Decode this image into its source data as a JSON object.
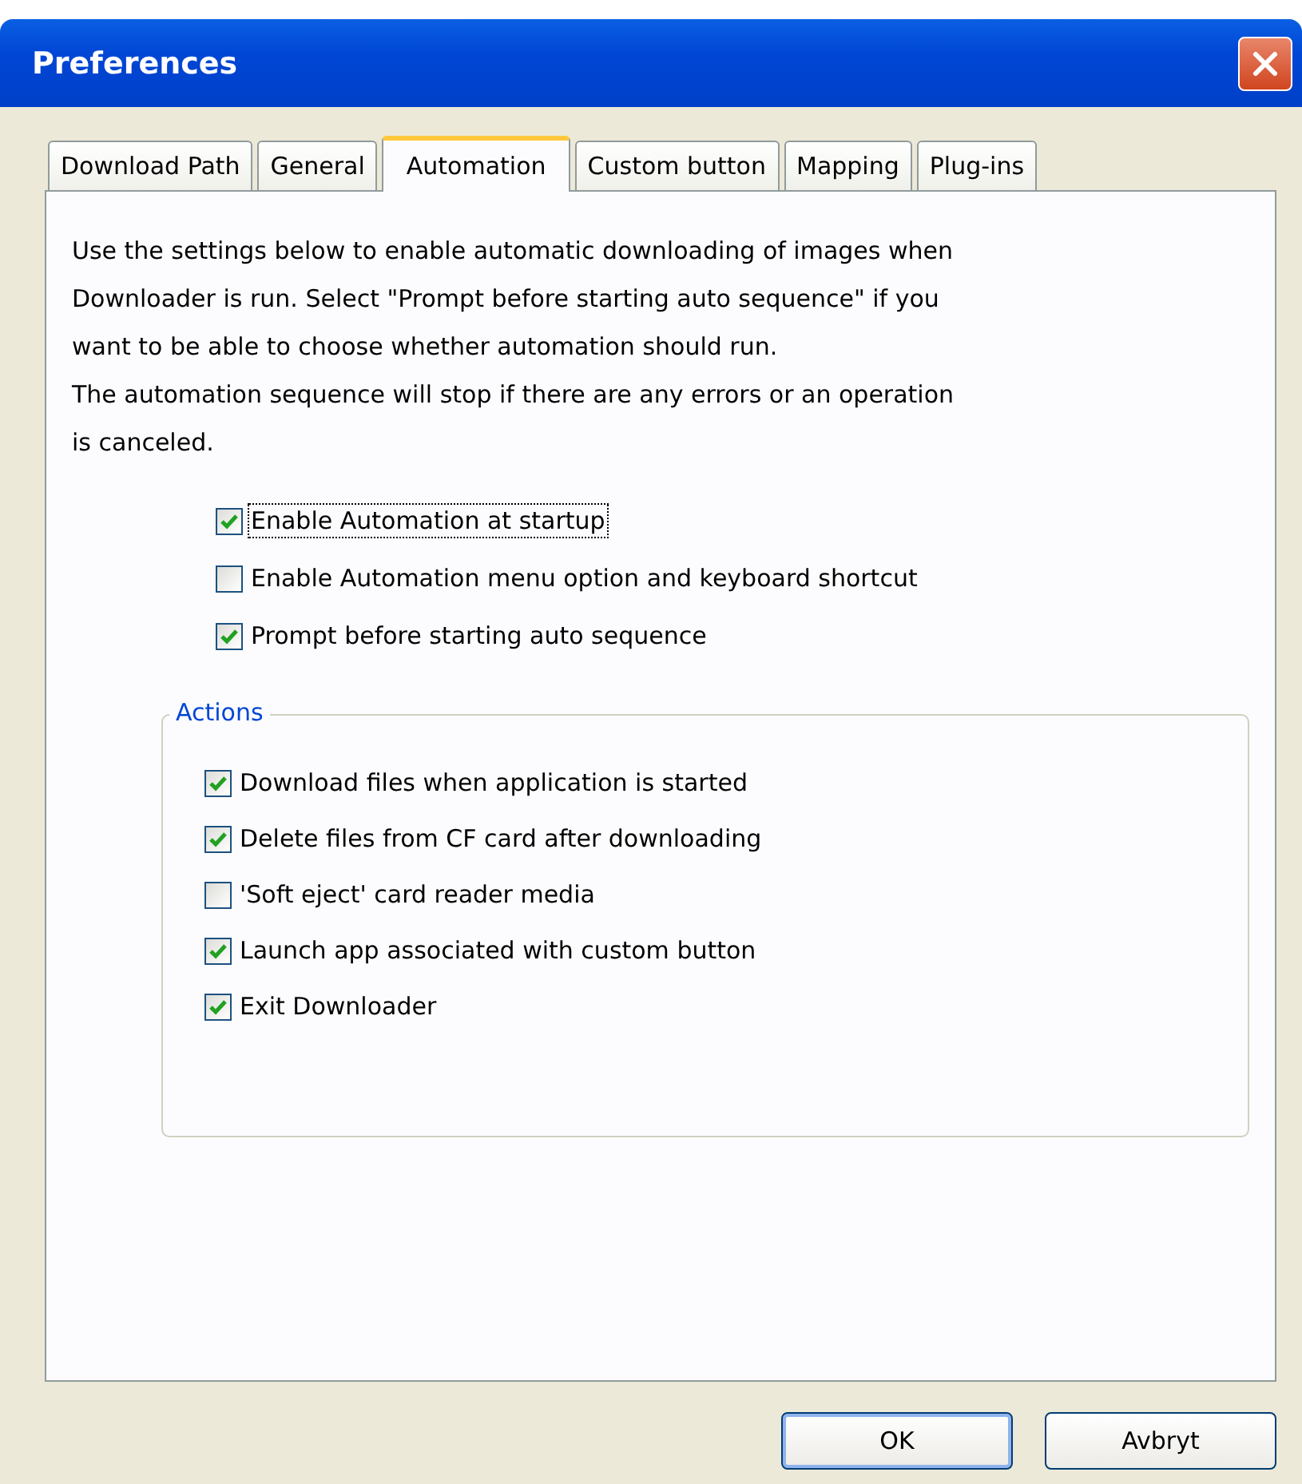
{
  "window": {
    "title": "Preferences"
  },
  "tabs": [
    {
      "label": "Download Path",
      "selected": false
    },
    {
      "label": "General",
      "selected": false
    },
    {
      "label": "Automation",
      "selected": true
    },
    {
      "label": "Custom button",
      "selected": false
    },
    {
      "label": "Mapping",
      "selected": false
    },
    {
      "label": "Plug-ins",
      "selected": false
    }
  ],
  "description": [
    "Use the settings below to enable automatic downloading of images when",
    "Downloader is run. Select \"Prompt before starting auto sequence\" if you",
    "want to be able to choose whether automation should run.",
    "The automation sequence will stop if there are any errors or an operation",
    "is canceled."
  ],
  "options": [
    {
      "label": "Enable Automation at startup",
      "checked": true,
      "focused": true
    },
    {
      "label": "Enable Automation menu option and keyboard shortcut",
      "checked": false,
      "focused": false
    },
    {
      "label": "Prompt before starting auto sequence",
      "checked": true,
      "focused": false
    }
  ],
  "actions": {
    "title": "Actions",
    "items": [
      {
        "label": "Download files when application is started",
        "checked": true
      },
      {
        "label": "Delete files from CF card after downloading",
        "checked": true
      },
      {
        "label": "'Soft eject' card reader media",
        "checked": false
      },
      {
        "label": "Launch app associated with custom button",
        "checked": true
      },
      {
        "label": "Exit Downloader",
        "checked": true
      }
    ]
  },
  "buttons": [
    {
      "label": "OK",
      "default": true
    },
    {
      "label": "Avbryt",
      "default": false
    }
  ]
}
